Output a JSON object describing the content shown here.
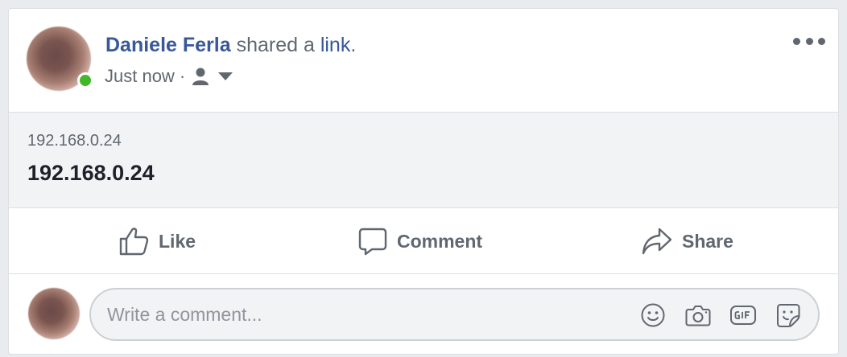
{
  "post": {
    "author": "Daniele Ferla",
    "shared_text": " shared a ",
    "link_word": "link",
    "period": ".",
    "timestamp": "Just now",
    "separator": "·",
    "audience_icon": "person-icon",
    "more_icon": "more-options-icon"
  },
  "link_preview": {
    "domain": "192.168.0.24",
    "title": "192.168.0.24"
  },
  "actions": [
    {
      "label": "Like",
      "icon": "thumbs-up-icon"
    },
    {
      "label": "Comment",
      "icon": "comment-bubble-icon"
    },
    {
      "label": "Share",
      "icon": "share-arrow-icon"
    }
  ],
  "composer": {
    "placeholder": "Write a comment...",
    "icons": [
      "smiley-icon",
      "camera-icon",
      "gif-icon",
      "sticker-icon"
    ]
  },
  "colors": {
    "author_link": "#385898",
    "secondary_text": "#616770",
    "online": "#42b72a",
    "preview_bg": "#f2f3f5"
  }
}
